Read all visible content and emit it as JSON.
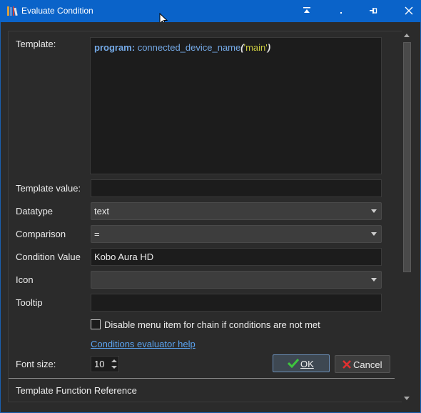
{
  "window": {
    "title": "Evaluate Condition",
    "controls": [
      "minimize-to-top",
      "minimize",
      "pin",
      "close"
    ]
  },
  "form": {
    "template_label": "Template:",
    "template_code": {
      "keyword": "program:",
      "function": "connected_device_name",
      "open_paren": "(",
      "string_arg": "'main'",
      "close_paren": ")"
    },
    "template_value_label": "Template value:",
    "template_value": "",
    "datatype_label": "Datatype",
    "datatype_value": "text",
    "comparison_label": "Comparison",
    "comparison_value": "=",
    "condition_value_label": "Condition Value",
    "condition_value": "Kobo Aura HD",
    "icon_label": "Icon",
    "icon_value": "",
    "tooltip_label": "Tooltip",
    "tooltip_value": "",
    "disable_checkbox_label": "Disable menu item for chain if conditions are not met",
    "disable_checkbox_checked": false,
    "help_link": "Conditions evaluator help",
    "font_size_label": "Font size:",
    "font_size_value": "10",
    "template_function_reference": "Template Function Reference"
  },
  "buttons": {
    "ok_label": "OK",
    "cancel_label": "Cancel"
  },
  "colors": {
    "titlebar": "#0a63c9",
    "background": "#2b2b2b",
    "keyword": "#74a9e6",
    "string": "#c9c940",
    "link": "#5aa3f0",
    "ok_check": "#3ec43e",
    "cancel_x": "#e03030"
  },
  "icons": {
    "app": "books-icon",
    "ok": "checkmark-icon",
    "cancel": "x-icon"
  }
}
